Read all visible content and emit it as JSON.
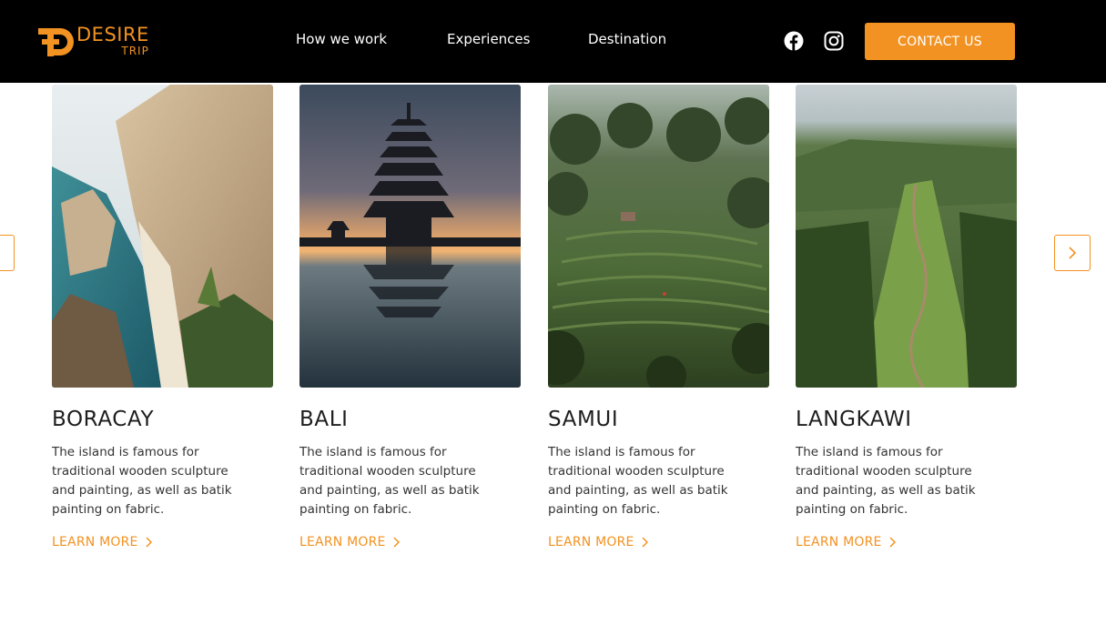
{
  "header": {
    "logo": {
      "main": "DESIRE",
      "sub": "TRIP"
    },
    "nav": [
      {
        "label": "How we work"
      },
      {
        "label": "Experiences"
      },
      {
        "label": "Destination"
      }
    ],
    "social": [
      "facebook-icon",
      "instagram-icon"
    ],
    "contact_label": "CONTACT US"
  },
  "colors": {
    "accent": "#f29222",
    "header_bg": "#000000"
  },
  "destinations": [
    {
      "title": "BORACAY",
      "description": "The island is famous for traditional wooden sculpture and painting, as well as batik painting on fabric.",
      "link": "LEARN MORE"
    },
    {
      "title": "BALI",
      "description": "The island is famous for traditional wooden sculpture and painting, as well as batik painting on fabric.",
      "link": "LEARN MORE"
    },
    {
      "title": "SAMUI",
      "description": "The island is famous for traditional wooden sculpture and painting, as well as batik painting on fabric.",
      "link": "LEARN MORE"
    },
    {
      "title": "LANGKAWI",
      "description": "The island is famous for traditional wooden sculpture and painting, as well as batik painting on fabric.",
      "link": "LEARN MORE"
    }
  ],
  "carousel": {
    "prev_icon": "chevron-left-icon",
    "next_icon": "chevron-right-icon"
  }
}
